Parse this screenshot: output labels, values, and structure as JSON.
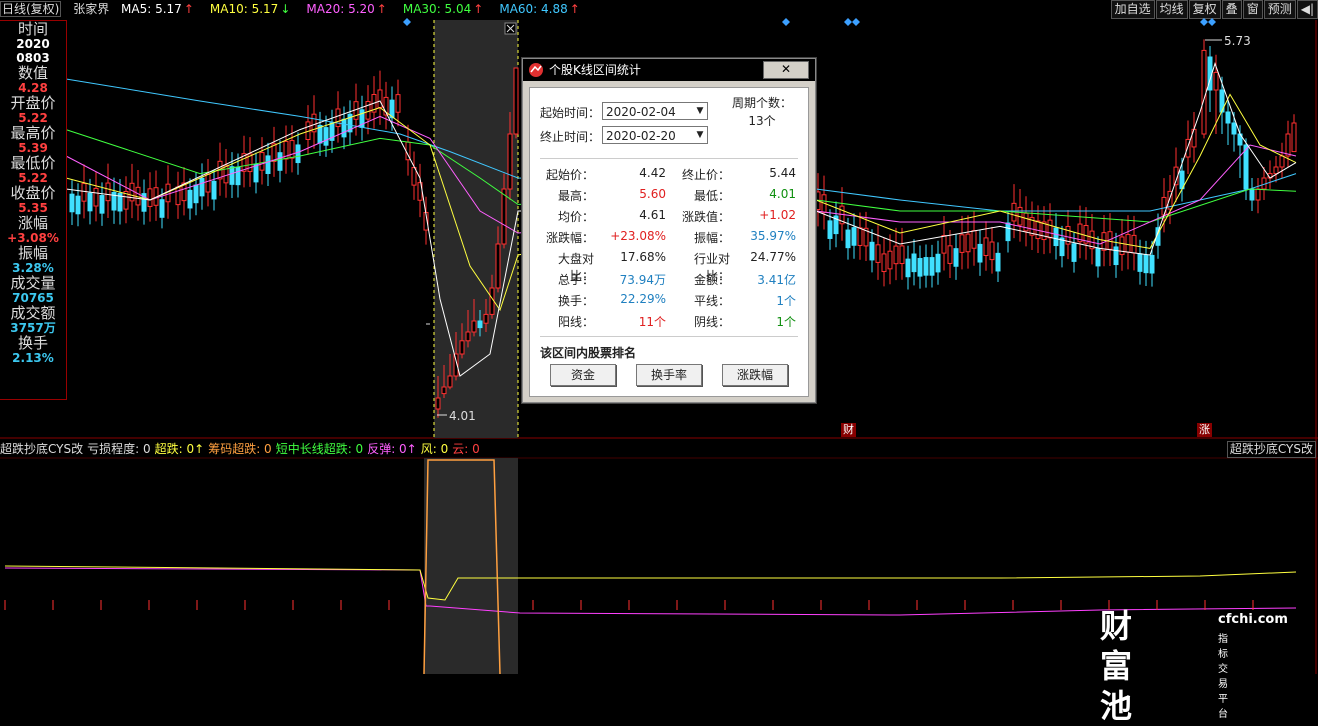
{
  "topbar": {
    "period": "日线(复权)",
    "stock": "张家界",
    "ma": [
      {
        "label": "MA5: 5.17",
        "arrow": "↑",
        "color": "#ffffff",
        "arrow_color": "#ff4040"
      },
      {
        "label": "MA10: 5.17",
        "arrow": "↓",
        "color": "#ffff40",
        "arrow_color": "#40ff40"
      },
      {
        "label": "MA20: 5.20",
        "arrow": "↑",
        "color": "#ff60ff",
        "arrow_color": "#ff4040"
      },
      {
        "label": "MA30: 5.04",
        "arrow": "↑",
        "color": "#40ff40",
        "arrow_color": "#ff4040"
      },
      {
        "label": "MA60: 4.88",
        "arrow": "↑",
        "color": "#40c8ff",
        "arrow_color": "#ff4040"
      }
    ],
    "buttons": [
      "加自选",
      "均线",
      "复权",
      "叠",
      "窗",
      "预测"
    ],
    "right_icon": "speaker-icon"
  },
  "left_panel": {
    "rows": [
      {
        "label": "时间",
        "value": "2020",
        "color": "#ffffff"
      },
      {
        "label": "",
        "value": "0803",
        "color": "#ffffff"
      },
      {
        "label": "数值",
        "value": "4.28",
        "color": "#ff4040"
      },
      {
        "label": "开盘价",
        "value": "5.22",
        "color": "#ff4040"
      },
      {
        "label": "最高价",
        "value": "5.39",
        "color": "#ff4040"
      },
      {
        "label": "最低价",
        "value": "5.22",
        "color": "#ff4040"
      },
      {
        "label": "收盘价",
        "value": "5.35",
        "color": "#ff4040"
      },
      {
        "label": "涨幅",
        "value": "+3.08%",
        "color": "#ff4040"
      },
      {
        "label": "振幅",
        "value": "3.28%",
        "color": "#3cc8f0"
      },
      {
        "label": "成交量",
        "value": "70765",
        "color": "#3cc8f0"
      },
      {
        "label": "成交额",
        "value": "3757万",
        "color": "#3cc8f0"
      },
      {
        "label": "换手",
        "value": "2.13%",
        "color": "#3cc8f0"
      }
    ]
  },
  "chart_labels": {
    "low_label": "4.01",
    "high_label": "5.73",
    "tag_cai": "财",
    "tag_zhang": "涨"
  },
  "dialog": {
    "title": "个股K线区间统计",
    "close": "✕",
    "start_label": "起始时间：",
    "start_value": "2020-02-04",
    "end_label": "终止时间：",
    "end_value": "2020-02-20",
    "cycle_label": "周期个数：",
    "cycle_value": "13个",
    "stats": [
      {
        "l": "起始价：",
        "v": "4.42",
        "vc": "dark",
        "l2": "终止价：",
        "v2": "5.44",
        "vc2": "dark"
      },
      {
        "l": "最高：",
        "v": "5.60",
        "vc": "red",
        "l2": "最低：",
        "v2": "4.01",
        "vc2": "green"
      },
      {
        "l": "均价：",
        "v": "4.61",
        "vc": "dark",
        "l2": "涨跌值：",
        "v2": "+1.02",
        "vc2": "red"
      },
      {
        "l": "涨跌幅：",
        "v": "+23.08%",
        "vc": "red",
        "l2": "振幅：",
        "v2": "35.97%",
        "vc2": "blue"
      },
      {
        "l": "大盘对比：",
        "v": "17.68%",
        "vc": "dark",
        "l2": "行业对比：",
        "v2": "24.77%",
        "vc2": "dark"
      },
      {
        "l": "总手：",
        "v": "73.94万",
        "vc": "blue",
        "l2": "金额：",
        "v2": "3.41亿",
        "vc2": "blue"
      },
      {
        "l": "换手：",
        "v": "22.29%",
        "vc": "blue",
        "l2": "平线：",
        "v2": "1个",
        "vc2": "blue"
      },
      {
        "l": "阳线：",
        "v": "11个",
        "vc": "red",
        "l2": "阴线：",
        "v2": "1个",
        "vc2": "green"
      }
    ],
    "rank_title": "该区间内股票排名",
    "rank_buttons": [
      "资金",
      "换手率",
      "涨跌幅"
    ]
  },
  "indicator": {
    "items": [
      {
        "text": "超跌抄底CYS改",
        "color": "#dddddd"
      },
      {
        "text": "亏损程度: 0",
        "color": "#dddddd"
      },
      {
        "text": "超跌: 0↑",
        "color": "#ffff40"
      },
      {
        "text": "筹码超跌: 0",
        "color": "#ffa040"
      },
      {
        "text": "短中长线超跌: 0",
        "color": "#40ff40"
      },
      {
        "text": "反弹: 0↑",
        "color": "#ff60ff"
      },
      {
        "text": "风: 0",
        "color": "#ffff40"
      },
      {
        "text": "云: 0",
        "color": "#ff4040"
      }
    ],
    "right_label": "超跌抄底CYS改"
  },
  "logo": {
    "main": "财富池",
    "url": "cfchi.com",
    "sub": "指标交易平台"
  }
}
